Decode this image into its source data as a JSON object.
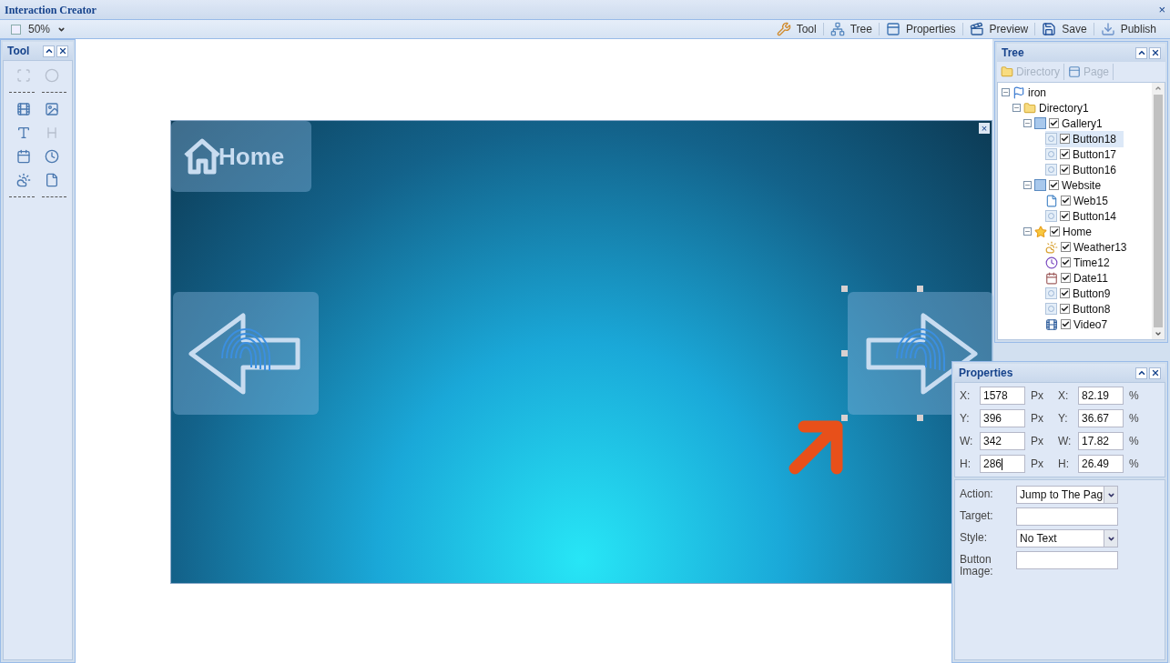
{
  "window": {
    "title": "Interaction Creator",
    "close": "×"
  },
  "toolbar": {
    "zoom": "50%",
    "buttons": [
      {
        "label": "Tool",
        "kind": "tool"
      },
      {
        "label": "Tree",
        "kind": "tree"
      },
      {
        "label": "Properties",
        "kind": "properties"
      },
      {
        "label": "Preview",
        "kind": "preview"
      },
      {
        "label": "Save",
        "kind": "save"
      },
      {
        "label": "Publish",
        "kind": "publish"
      }
    ]
  },
  "tool_panel": {
    "title": "Tool",
    "tools": [
      {
        "kind": "select",
        "disabled": true
      },
      {
        "kind": "button",
        "disabled": true
      },
      {
        "kind": "separator"
      },
      {
        "kind": "video",
        "disabled": false
      },
      {
        "kind": "image",
        "disabled": false
      },
      {
        "kind": "text",
        "disabled": false
      },
      {
        "kind": "title",
        "disabled": true
      },
      {
        "kind": "date",
        "disabled": false
      },
      {
        "kind": "time",
        "disabled": false
      },
      {
        "kind": "weather",
        "disabled": false
      },
      {
        "kind": "web",
        "disabled": false
      },
      {
        "kind": "separator"
      }
    ]
  },
  "canvas": {
    "close": "×",
    "elements": [
      {
        "kind": "home",
        "label": "Home",
        "selected": false
      },
      {
        "kind": "left-arrow",
        "selected": false
      },
      {
        "kind": "right-arrow",
        "selected": true
      }
    ]
  },
  "tree_panel": {
    "title": "Tree",
    "toolbar": [
      {
        "label": "Directory",
        "kind": "folder",
        "disabled": true
      },
      {
        "label": "Page",
        "kind": "page",
        "disabled": true
      }
    ],
    "items": [
      {
        "label": "iron",
        "kind": "project",
        "expanded": true,
        "selected": false,
        "children": [
          {
            "label": "Directory1",
            "kind": "folder",
            "expanded": true,
            "selected": false,
            "children": [
              {
                "label": "Gallery1",
                "kind": "gallery",
                "checked": true,
                "expanded": true,
                "selected": false,
                "children": [
                  {
                    "label": "Button18",
                    "kind": "button",
                    "checked": true,
                    "selected": true
                  },
                  {
                    "label": "Button17",
                    "kind": "button",
                    "checked": true,
                    "selected": false
                  },
                  {
                    "label": "Button16",
                    "kind": "button",
                    "checked": true,
                    "selected": false
                  }
                ]
              },
              {
                "label": "Website",
                "kind": "gallery",
                "checked": true,
                "expanded": true,
                "selected": false,
                "children": [
                  {
                    "label": "Web15",
                    "kind": "web",
                    "checked": true,
                    "selected": false
                  },
                  {
                    "label": "Button14",
                    "kind": "button",
                    "checked": true,
                    "selected": false
                  }
                ]
              },
              {
                "label": "Home",
                "kind": "home",
                "checked": true,
                "expanded": true,
                "selected": false,
                "children": [
                  {
                    "label": "Weather13",
                    "kind": "weather",
                    "checked": true,
                    "selected": false
                  },
                  {
                    "label": "Time12",
                    "kind": "time",
                    "checked": true,
                    "selected": false
                  },
                  {
                    "label": "Date11",
                    "kind": "date",
                    "checked": true,
                    "selected": false
                  },
                  {
                    "label": "Button9",
                    "kind": "button",
                    "checked": true,
                    "selected": false
                  },
                  {
                    "label": "Button8",
                    "kind": "button",
                    "checked": true,
                    "selected": false
                  },
                  {
                    "label": "Video7",
                    "kind": "video",
                    "checked": true,
                    "selected": false
                  }
                ]
              }
            ]
          }
        ]
      }
    ]
  },
  "properties": {
    "title": "Properties",
    "geometry": [
      {
        "axis": "X:",
        "px": "1578",
        "unit": "Px",
        "pct_axis": "X:",
        "pct": "82.19",
        "pct_unit": "%",
        "focused": false
      },
      {
        "axis": "Y:",
        "px": "396",
        "unit": "Px",
        "pct_axis": "Y:",
        "pct": "36.67",
        "pct_unit": "%",
        "focused": false
      },
      {
        "axis": "W:",
        "px": "342",
        "unit": "Px",
        "pct_axis": "W:",
        "pct": "17.82",
        "pct_unit": "%",
        "focused": false
      },
      {
        "axis": "H:",
        "px": "286",
        "unit": "Px",
        "pct_axis": "H:",
        "pct": "26.49",
        "pct_unit": "%",
        "focused": true
      }
    ],
    "settings": [
      {
        "label": "Action:",
        "kind": "select",
        "value": "Jump to The Pag"
      },
      {
        "label": "Target:",
        "kind": "text"
      },
      {
        "label": "Style:",
        "kind": "select",
        "value": "No Text"
      },
      {
        "label": "Button Image:",
        "kind": "text"
      }
    ]
  }
}
